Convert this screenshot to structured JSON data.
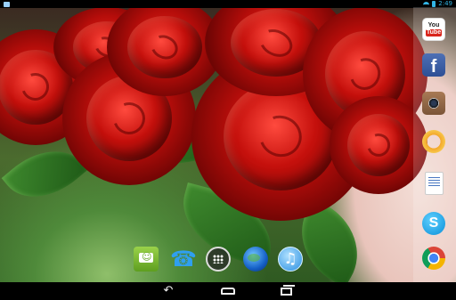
{
  "status_bar": {
    "clock": "2:49",
    "accent_color": "#33b5e5"
  },
  "right_dock": {
    "apps": [
      {
        "name": "youtube-app",
        "label_top": "You",
        "label_bottom": "Tube"
      },
      {
        "name": "facebook-app",
        "glyph": "f"
      },
      {
        "name": "camera-app"
      },
      {
        "name": "yellow-ring-app"
      },
      {
        "name": "docs-app"
      },
      {
        "name": "skype-app",
        "glyph": "S"
      },
      {
        "name": "chrome-app"
      }
    ]
  },
  "hotseat": {
    "apps": [
      {
        "name": "messaging-app"
      },
      {
        "name": "phone-app",
        "glyph": "☎"
      },
      {
        "name": "app-drawer"
      },
      {
        "name": "browser-app"
      },
      {
        "name": "music-app",
        "glyph": "♫"
      }
    ]
  },
  "nav_bar": {
    "back_glyph": "↶"
  }
}
